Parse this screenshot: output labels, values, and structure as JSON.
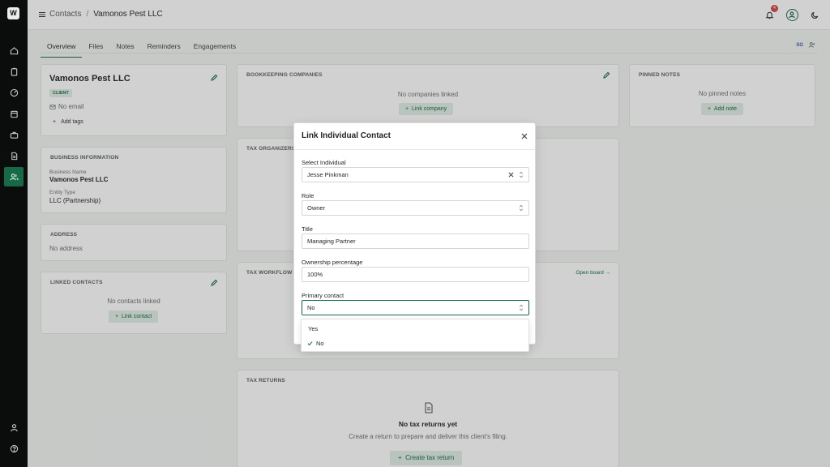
{
  "logo": {
    "glyph": "W"
  },
  "sidebar": {
    "items": [
      {
        "icon": "home-icon"
      },
      {
        "icon": "clipboard-icon"
      },
      {
        "icon": "gauge-icon"
      },
      {
        "icon": "calendar-icon"
      },
      {
        "icon": "briefcase-icon"
      },
      {
        "icon": "document-icon"
      },
      {
        "icon": "contacts-icon",
        "active": true
      }
    ],
    "bottom": [
      {
        "icon": "user-icon"
      },
      {
        "icon": "help-icon"
      }
    ]
  },
  "breadcrumb": {
    "parent": "Contacts",
    "separator": "/",
    "current": "Vamonos Pest LLC"
  },
  "topbar": {
    "notification_count": "4"
  },
  "tabs": [
    "Overview",
    "Files",
    "Notes",
    "Reminders",
    "Engagements"
  ],
  "tabs_right": {
    "label": "SG"
  },
  "profile": {
    "name": "Vamonos Pest LLC",
    "tag": "CLIENT",
    "email": "No email",
    "add_tags": "Add tags"
  },
  "business_info": {
    "heading": "BUSINESS INFORMATION",
    "business_name_label": "Business Name",
    "business_name": "Vamonos Pest LLC",
    "entity_type_label": "Entity Type",
    "entity_type": "LLC (Partnership)"
  },
  "address": {
    "heading": "ADDRESS",
    "value": "No address"
  },
  "linked_contacts": {
    "heading": "LINKED CONTACTS",
    "empty": "No contacts linked",
    "button": "Link contact"
  },
  "bookkeeping": {
    "heading": "BOOKKEEPING COMPANIES",
    "empty": "No companies linked",
    "button": "Link company"
  },
  "tax_organizers": {
    "heading": "TAX ORGANIZERS"
  },
  "tax_workflow": {
    "heading": "TAX WORKFLOW",
    "link": "Open board →"
  },
  "pinned_notes": {
    "heading": "PINNED NOTES",
    "empty": "No pinned notes",
    "button": "Add note"
  },
  "tax_returns": {
    "heading": "TAX RETURNS",
    "empty_title": "No tax returns yet",
    "empty_desc": "Create a return to prepare and deliver this client's filing.",
    "button": "Create tax return"
  },
  "modal": {
    "title": "Link Individual Contact",
    "fields": {
      "individual": {
        "label": "Select Individual",
        "value": "Jesse Pinkman"
      },
      "role": {
        "label": "Role",
        "value": "Owner"
      },
      "title": {
        "label": "Title",
        "value": "Managing Partner"
      },
      "ownership": {
        "label": "Ownership percentage",
        "value": "100%"
      },
      "primary": {
        "label": "Primary contact",
        "value": "No"
      }
    },
    "dropdown_options": [
      "Yes",
      "No"
    ],
    "selected_option": "No"
  },
  "colors": {
    "brand": "#166a47",
    "sidebar_bg": "#0b0c0c",
    "badge": "#d34848"
  }
}
